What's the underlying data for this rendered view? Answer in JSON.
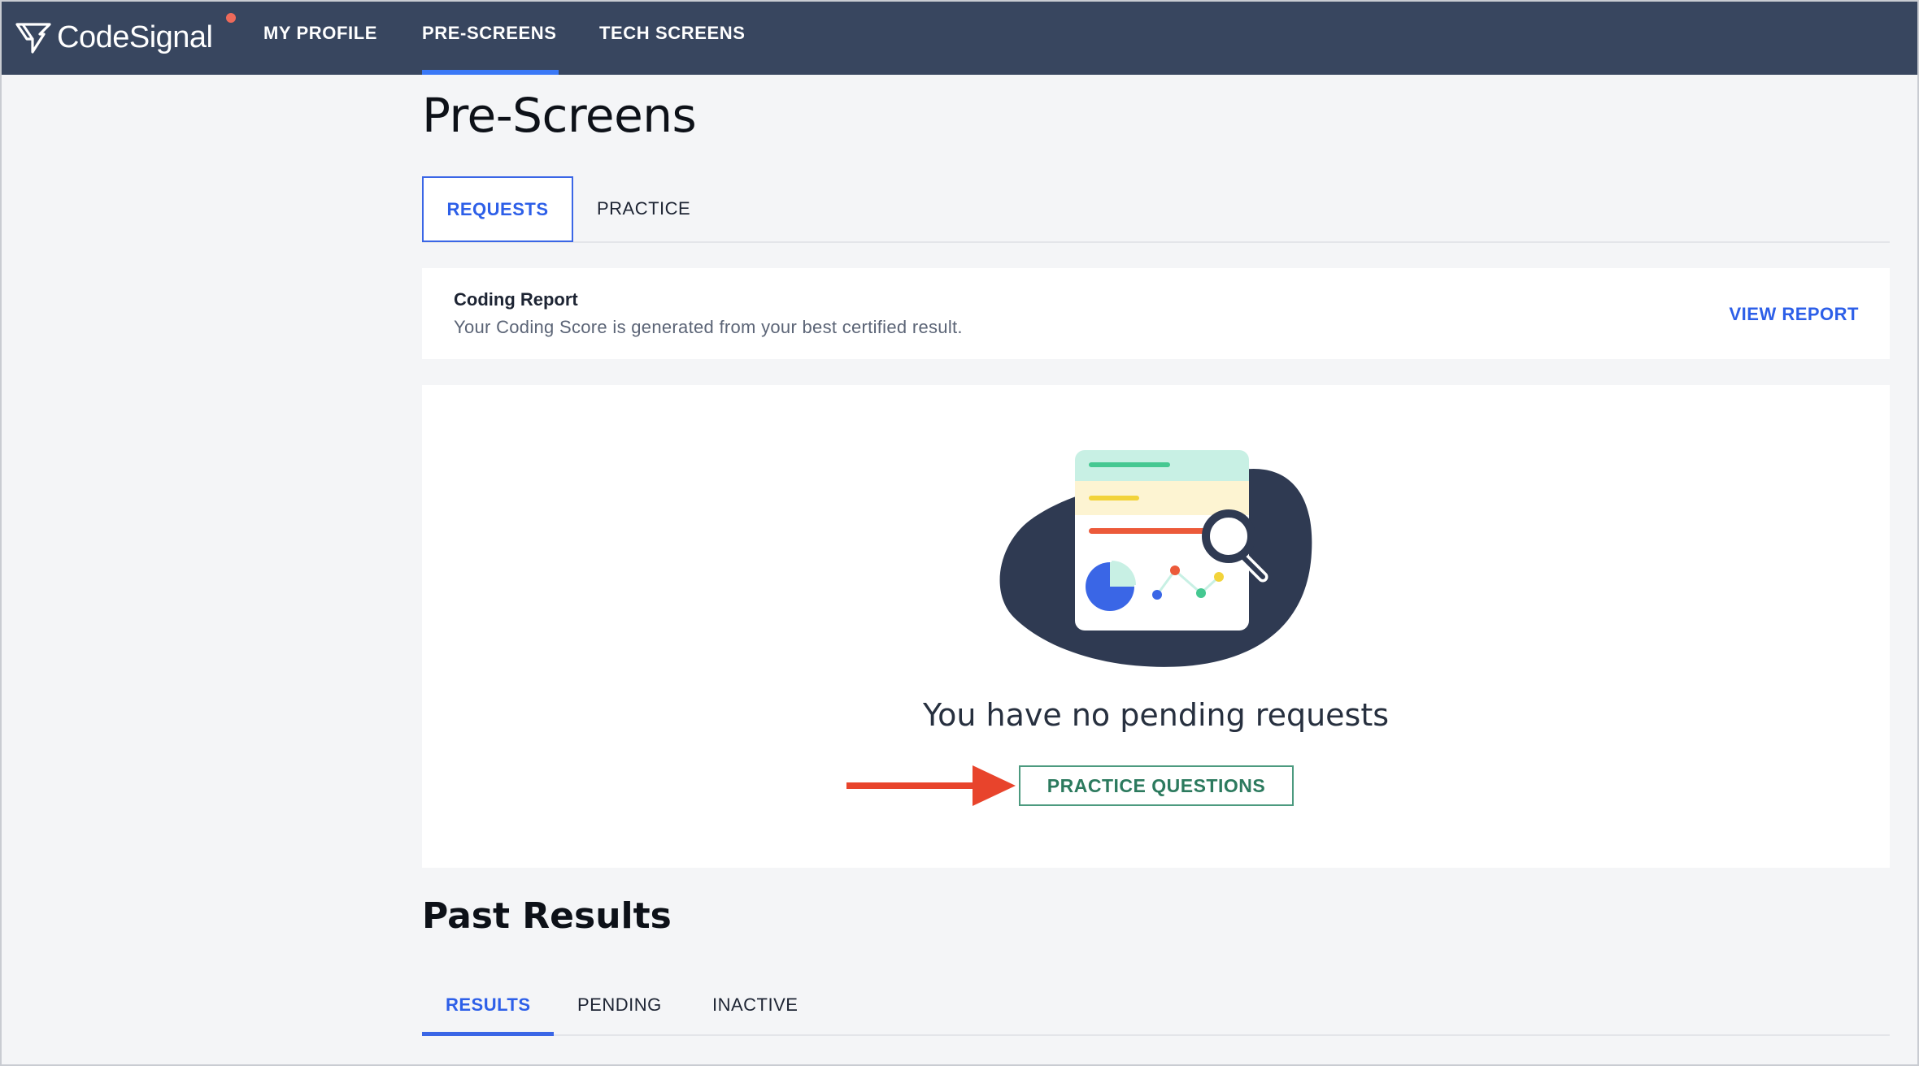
{
  "app": {
    "brand": "CodeSignal"
  },
  "nav": {
    "items": [
      {
        "label": "MY PROFILE",
        "active": false
      },
      {
        "label": "PRE-SCREENS",
        "active": true
      },
      {
        "label": "TECH SCREENS",
        "active": false
      }
    ]
  },
  "page": {
    "title": "Pre-Screens"
  },
  "tabs": {
    "requests": "REQUESTS",
    "practice": "PRACTICE",
    "active": "REQUESTS"
  },
  "report": {
    "title": "Coding Report",
    "description": "Your Coding Score is generated from your best certified result.",
    "link": "VIEW REPORT"
  },
  "empty_state": {
    "message": "You have no pending requests",
    "button": "PRACTICE QUESTIONS"
  },
  "past_results": {
    "title": "Past Results",
    "tabs": [
      "RESULTS",
      "PENDING",
      "INACTIVE"
    ],
    "active": "RESULTS"
  },
  "colors": {
    "nav_bg": "#38465f",
    "accent_blue": "#2d5fe8",
    "practice_green": "#2c7a5e",
    "annotation_arrow": "#e8442c",
    "notification_dot": "#ee6a5a"
  }
}
